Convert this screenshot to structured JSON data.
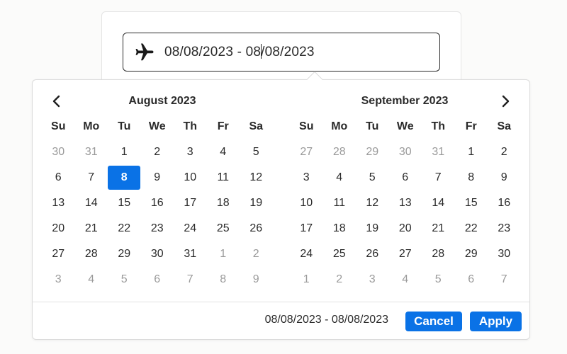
{
  "input": {
    "value_before_caret": "08/08/2023 - 08",
    "value_after_caret": "/08/2023",
    "icon": "airplane-icon"
  },
  "nav": {
    "prev_icon": "chevron-left-icon",
    "next_icon": "chevron-right-icon"
  },
  "weekdays": [
    "Su",
    "Mo",
    "Tu",
    "We",
    "Th",
    "Fr",
    "Sa"
  ],
  "months": [
    {
      "title": "August 2023",
      "days": [
        {
          "d": "30",
          "muted": true
        },
        {
          "d": "31",
          "muted": true
        },
        {
          "d": "1"
        },
        {
          "d": "2"
        },
        {
          "d": "3"
        },
        {
          "d": "4"
        },
        {
          "d": "5"
        },
        {
          "d": "6"
        },
        {
          "d": "7"
        },
        {
          "d": "8",
          "selected": true
        },
        {
          "d": "9"
        },
        {
          "d": "10"
        },
        {
          "d": "11"
        },
        {
          "d": "12"
        },
        {
          "d": "13"
        },
        {
          "d": "14"
        },
        {
          "d": "15"
        },
        {
          "d": "16"
        },
        {
          "d": "17"
        },
        {
          "d": "18"
        },
        {
          "d": "19"
        },
        {
          "d": "20"
        },
        {
          "d": "21"
        },
        {
          "d": "22"
        },
        {
          "d": "23"
        },
        {
          "d": "24"
        },
        {
          "d": "25"
        },
        {
          "d": "26"
        },
        {
          "d": "27"
        },
        {
          "d": "28"
        },
        {
          "d": "29"
        },
        {
          "d": "30"
        },
        {
          "d": "31"
        },
        {
          "d": "1",
          "muted": true
        },
        {
          "d": "2",
          "muted": true
        },
        {
          "d": "3",
          "muted": true
        },
        {
          "d": "4",
          "muted": true
        },
        {
          "d": "5",
          "muted": true
        },
        {
          "d": "6",
          "muted": true
        },
        {
          "d": "7",
          "muted": true
        },
        {
          "d": "8",
          "muted": true
        },
        {
          "d": "9",
          "muted": true
        }
      ]
    },
    {
      "title": "September 2023",
      "days": [
        {
          "d": "27",
          "muted": true
        },
        {
          "d": "28",
          "muted": true
        },
        {
          "d": "29",
          "muted": true
        },
        {
          "d": "30",
          "muted": true
        },
        {
          "d": "31",
          "muted": true
        },
        {
          "d": "1"
        },
        {
          "d": "2"
        },
        {
          "d": "3"
        },
        {
          "d": "4"
        },
        {
          "d": "5"
        },
        {
          "d": "6"
        },
        {
          "d": "7"
        },
        {
          "d": "8"
        },
        {
          "d": "9"
        },
        {
          "d": "10"
        },
        {
          "d": "11"
        },
        {
          "d": "12"
        },
        {
          "d": "13"
        },
        {
          "d": "14"
        },
        {
          "d": "15"
        },
        {
          "d": "16"
        },
        {
          "d": "17"
        },
        {
          "d": "18"
        },
        {
          "d": "19"
        },
        {
          "d": "20"
        },
        {
          "d": "21"
        },
        {
          "d": "22"
        },
        {
          "d": "23"
        },
        {
          "d": "24"
        },
        {
          "d": "25"
        },
        {
          "d": "26"
        },
        {
          "d": "27"
        },
        {
          "d": "28"
        },
        {
          "d": "29"
        },
        {
          "d": "30"
        },
        {
          "d": "1",
          "muted": true
        },
        {
          "d": "2",
          "muted": true
        },
        {
          "d": "3",
          "muted": true
        },
        {
          "d": "4",
          "muted": true
        },
        {
          "d": "5",
          "muted": true
        },
        {
          "d": "6",
          "muted": true
        },
        {
          "d": "7",
          "muted": true
        }
      ]
    }
  ],
  "footer": {
    "range_text": "08/08/2023 - 08/08/2023",
    "cancel_label": "Cancel",
    "apply_label": "Apply"
  },
  "colors": {
    "accent": "#0a72e6",
    "muted_text": "#9a9a9a",
    "text": "#2a2a2a"
  }
}
